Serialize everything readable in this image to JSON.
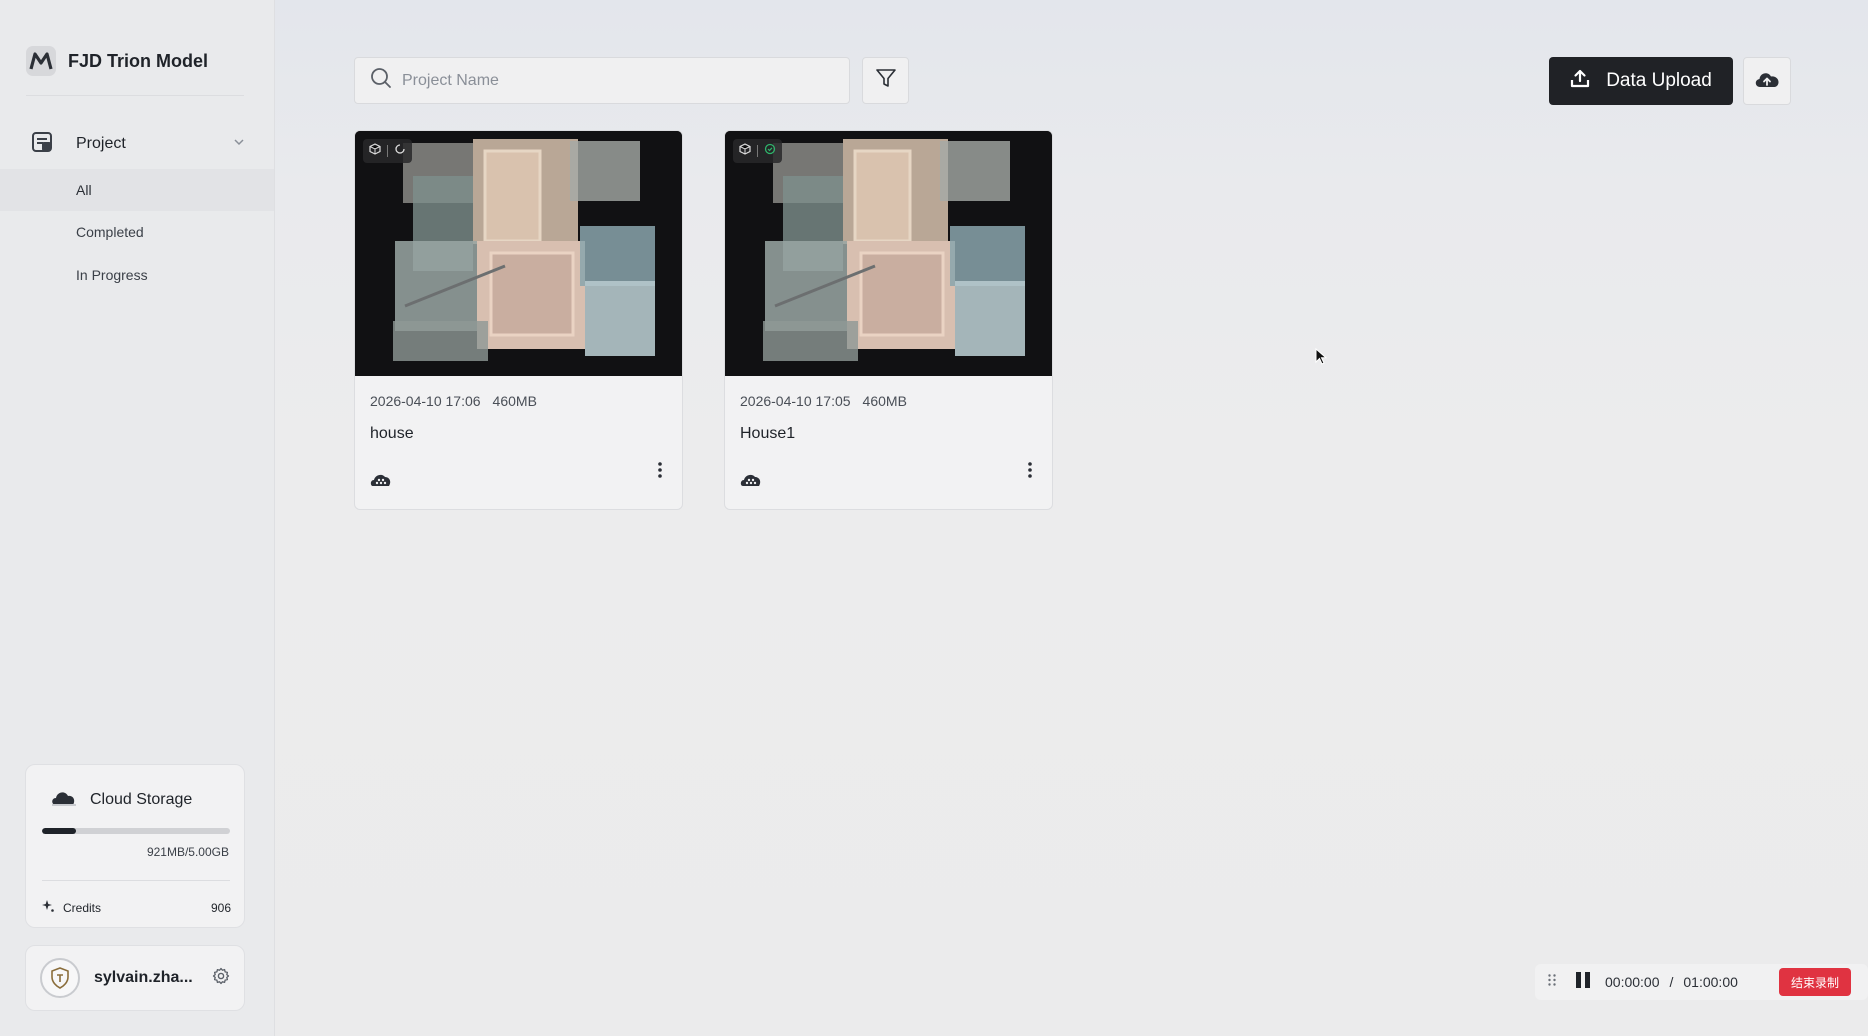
{
  "app": {
    "title": "FJD Trion Model"
  },
  "sidebar": {
    "group": {
      "label": "Project"
    },
    "items": [
      {
        "label": "All",
        "active": true
      },
      {
        "label": "Completed",
        "active": false
      },
      {
        "label": "In Progress",
        "active": false
      }
    ],
    "storage": {
      "title": "Cloud Storage",
      "usage_text": "921MB/5.00GB",
      "used_fraction": 0.18,
      "credits_label": "Credits",
      "credits_value": "906"
    },
    "user": {
      "name": "sylvain.zha..."
    }
  },
  "toolbar": {
    "search_placeholder": "Project Name",
    "upload_label": "Data Upload"
  },
  "projects": [
    {
      "date": "2026-04-10 17:06",
      "size": "460MB",
      "name": "house",
      "status_icon": "processing-icon"
    },
    {
      "date": "2026-04-10 17:05",
      "size": "460MB",
      "name": "House1",
      "status_icon": "completed-icon"
    }
  ],
  "recorder": {
    "elapsed": "00:00:00",
    "separator": "/",
    "limit": "01:00:00",
    "stop_label": "结束录制"
  },
  "colors": {
    "accent": "#202226",
    "stop": "#e03341",
    "success": "#2fb36b"
  }
}
